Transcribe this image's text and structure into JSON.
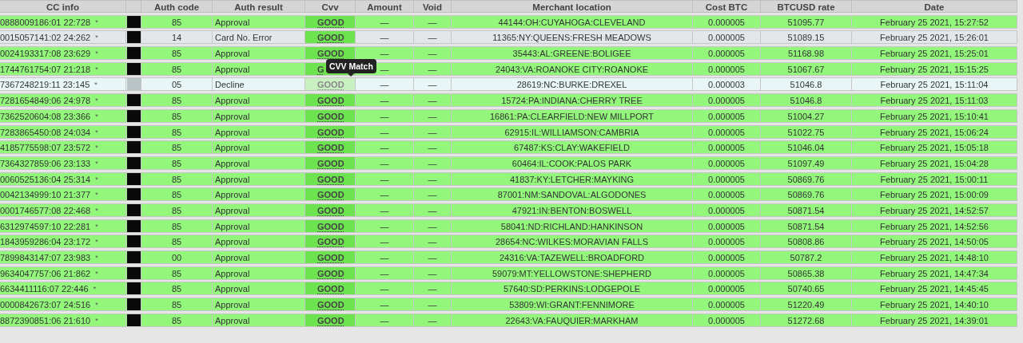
{
  "table": {
    "columns": [
      "CC info",
      "",
      "Auth code",
      "Auth result",
      "Cvv",
      "Amount",
      "Void",
      "Merchant location",
      "Cost BTC",
      "BTCUSD rate",
      "Date"
    ],
    "rows": [
      {
        "kind": "approved",
        "cc_info": "0888009186:01 22:728",
        "mark": "*",
        "auth_code": "85",
        "auth_result": "Approval",
        "cvv": "GOOD",
        "amount": "—",
        "void": "—",
        "merchant_location": "44144:OH:CUYAHOGA:CLEVELAND",
        "cost_btc": "0.000005",
        "btcusd_rate": "51095.77",
        "date": "February 25 2021, 15:27:52"
      },
      {
        "kind": "error",
        "cc_info": "0015057141:02 24:262",
        "mark": "*",
        "auth_code": "14",
        "auth_result": "Card No. Error",
        "cvv": "GOOD",
        "amount": "—",
        "void": "—",
        "merchant_location": "11365:NY:QUEENS:FRESH MEADOWS",
        "cost_btc": "0.000005",
        "btcusd_rate": "51089.15",
        "date": "February 25 2021, 15:26:01"
      },
      {
        "kind": "approved",
        "cc_info": "0024193317:08 23:629",
        "mark": "*",
        "auth_code": "85",
        "auth_result": "Approval",
        "cvv": "GOOD",
        "amount": "—",
        "void": "—",
        "merchant_location": "35443:AL:GREENE:BOLIGEE",
        "cost_btc": "0.000005",
        "btcusd_rate": "51168.98",
        "date": "February 25 2021, 15:25:01"
      },
      {
        "kind": "approved",
        "cc_info": "1744761754:07 21:218",
        "mark": "*",
        "auth_code": "85",
        "auth_result": "Approval",
        "cvv": "G",
        "amount": "—",
        "void": "—",
        "merchant_location": "24043:VA:ROANOKE CITY:ROANOKE",
        "cost_btc": "0.000005",
        "btcusd_rate": "51067.67",
        "date": "February 25 2021, 15:15:25"
      },
      {
        "kind": "declined",
        "cc_info": "7367248219:11 23:145",
        "mark": "*",
        "auth_code": "05",
        "auth_result": "Decline",
        "cvv": "GOOD",
        "tooltip": "CVV Match",
        "amount": "—",
        "void": "—",
        "merchant_location": "28619:NC:BURKE:DREXEL",
        "cost_btc": "0.000003",
        "btcusd_rate": "51046.8",
        "date": "February 25 2021, 15:11:04"
      },
      {
        "kind": "approved",
        "cc_info": "7281654849:06 24:978",
        "mark": "*",
        "auth_code": "85",
        "auth_result": "Approval",
        "cvv": "GOOD",
        "amount": "—",
        "void": "—",
        "merchant_location": "15724:PA:INDIANA:CHERRY TREE",
        "cost_btc": "0.000005",
        "btcusd_rate": "51046.8",
        "date": "February 25 2021, 15:11:03"
      },
      {
        "kind": "approved",
        "cc_info": "7362520604:08 23:366",
        "mark": "*",
        "auth_code": "85",
        "auth_result": "Approval",
        "cvv": "GOOD",
        "amount": "—",
        "void": "—",
        "merchant_location": "16861:PA:CLEARFIELD:NEW MILLPORT",
        "cost_btc": "0.000005",
        "btcusd_rate": "51004.27",
        "date": "February 25 2021, 15:10:41"
      },
      {
        "kind": "approved",
        "cc_info": "7283865450:08 24:034",
        "mark": "*",
        "auth_code": "85",
        "auth_result": "Approval",
        "cvv": "GOOD",
        "amount": "—",
        "void": "—",
        "merchant_location": "62915:IL:WILLIAMSON:CAMBRIA",
        "cost_btc": "0.000005",
        "btcusd_rate": "51022.75",
        "date": "February 25 2021, 15:06:24"
      },
      {
        "kind": "approved",
        "cc_info": "4185775598:07 23:572",
        "mark": "*",
        "auth_code": "85",
        "auth_result": "Approval",
        "cvv": "GOOD",
        "amount": "—",
        "void": "—",
        "merchant_location": "67487:KS:CLAY:WAKEFIELD",
        "cost_btc": "0.000005",
        "btcusd_rate": "51046.04",
        "date": "February 25 2021, 15:05:18"
      },
      {
        "kind": "approved",
        "cc_info": "7364327859:06 23:133",
        "mark": "*",
        "auth_code": "85",
        "auth_result": "Approval",
        "cvv": "GOOD",
        "amount": "—",
        "void": "—",
        "merchant_location": "60464:IL:COOK:PALOS PARK",
        "cost_btc": "0.000005",
        "btcusd_rate": "51097.49",
        "date": "February 25 2021, 15:04:28"
      },
      {
        "kind": "approved",
        "cc_info": "0060525136:04 25:314",
        "mark": "*",
        "auth_code": "85",
        "auth_result": "Approval",
        "cvv": "GOOD",
        "amount": "—",
        "void": "—",
        "merchant_location": "41837:KY:LETCHER:MAYKING",
        "cost_btc": "0.000005",
        "btcusd_rate": "50869.76",
        "date": "February 25 2021, 15:00:11"
      },
      {
        "kind": "approved",
        "cc_info": "0042134999:10 21:377",
        "mark": "*",
        "auth_code": "85",
        "auth_result": "Approval",
        "cvv": "GOOD",
        "amount": "—",
        "void": "—",
        "merchant_location": "87001:NM:SANDOVAL:ALGODONES",
        "cost_btc": "0.000005",
        "btcusd_rate": "50869.76",
        "date": "February 25 2021, 15:00:09"
      },
      {
        "kind": "approved",
        "cc_info": "0001746577:08 22:468",
        "mark": "*",
        "auth_code": "85",
        "auth_result": "Approval",
        "cvv": "GOOD",
        "amount": "—",
        "void": "—",
        "merchant_location": "47921:IN:BENTON:BOSWELL",
        "cost_btc": "0.000005",
        "btcusd_rate": "50871.54",
        "date": "February 25 2021, 14:52:57"
      },
      {
        "kind": "approved",
        "cc_info": "6312974597:10 22:281",
        "mark": "*",
        "auth_code": "85",
        "auth_result": "Approval",
        "cvv": "GOOD",
        "amount": "—",
        "void": "—",
        "merchant_location": "58041:ND:RICHLAND:HANKINSON",
        "cost_btc": "0.000005",
        "btcusd_rate": "50871.54",
        "date": "February 25 2021, 14:52:56"
      },
      {
        "kind": "approved",
        "cc_info": "1843959286:04 23:172",
        "mark": "*",
        "auth_code": "85",
        "auth_result": "Approval",
        "cvv": "GOOD",
        "amount": "—",
        "void": "—",
        "merchant_location": "28654:NC:WILKES:MORAVIAN FALLS",
        "cost_btc": "0.000005",
        "btcusd_rate": "50808.86",
        "date": "February 25 2021, 14:50:05"
      },
      {
        "kind": "approved",
        "cc_info": "7899843147:07 23:983",
        "mark": "*",
        "auth_code": "00",
        "auth_result": "Approval",
        "cvv": "GOOD",
        "amount": "—",
        "void": "—",
        "merchant_location": "24316:VA:TAZEWELL:BROADFORD",
        "cost_btc": "0.000005",
        "btcusd_rate": "50787.2",
        "date": "February 25 2021, 14:48:10"
      },
      {
        "kind": "approved",
        "cc_info": "9634047757:06 21:862",
        "mark": "*",
        "auth_code": "85",
        "auth_result": "Approval",
        "cvv": "GOOD",
        "amount": "—",
        "void": "—",
        "merchant_location": "59079:MT:YELLOWSTONE:SHEPHERD",
        "cost_btc": "0.000005",
        "btcusd_rate": "50865.38",
        "date": "February 25 2021, 14:47:34"
      },
      {
        "kind": "approved",
        "cc_info": "6634411116:07 22:446",
        "mark": "*",
        "auth_code": "85",
        "auth_result": "Approval",
        "cvv": "GOOD",
        "amount": "—",
        "void": "—",
        "merchant_location": "57640:SD:PERKINS:LODGEPOLE",
        "cost_btc": "0.000005",
        "btcusd_rate": "50740.65",
        "date": "February 25 2021, 14:45:45"
      },
      {
        "kind": "approved",
        "cc_info": "0000842673:07 24:516",
        "mark": "*",
        "auth_code": "85",
        "auth_result": "Approval",
        "cvv": "GOOD",
        "amount": "—",
        "void": "—",
        "merchant_location": "53809:WI:GRANT:FENNIMORE",
        "cost_btc": "0.000005",
        "btcusd_rate": "51220.49",
        "date": "February 25 2021, 14:40:10"
      },
      {
        "kind": "approved",
        "cc_info": "8872390851:06 21:610",
        "mark": "*",
        "auth_code": "85",
        "auth_result": "Approval",
        "cvv": "GOOD",
        "amount": "—",
        "void": "—",
        "merchant_location": "22643:VA:FAUQUIER:MARKHAM",
        "cost_btc": "0.000005",
        "btcusd_rate": "51272.68",
        "date": "February 25 2021, 14:39:01"
      }
    ]
  }
}
